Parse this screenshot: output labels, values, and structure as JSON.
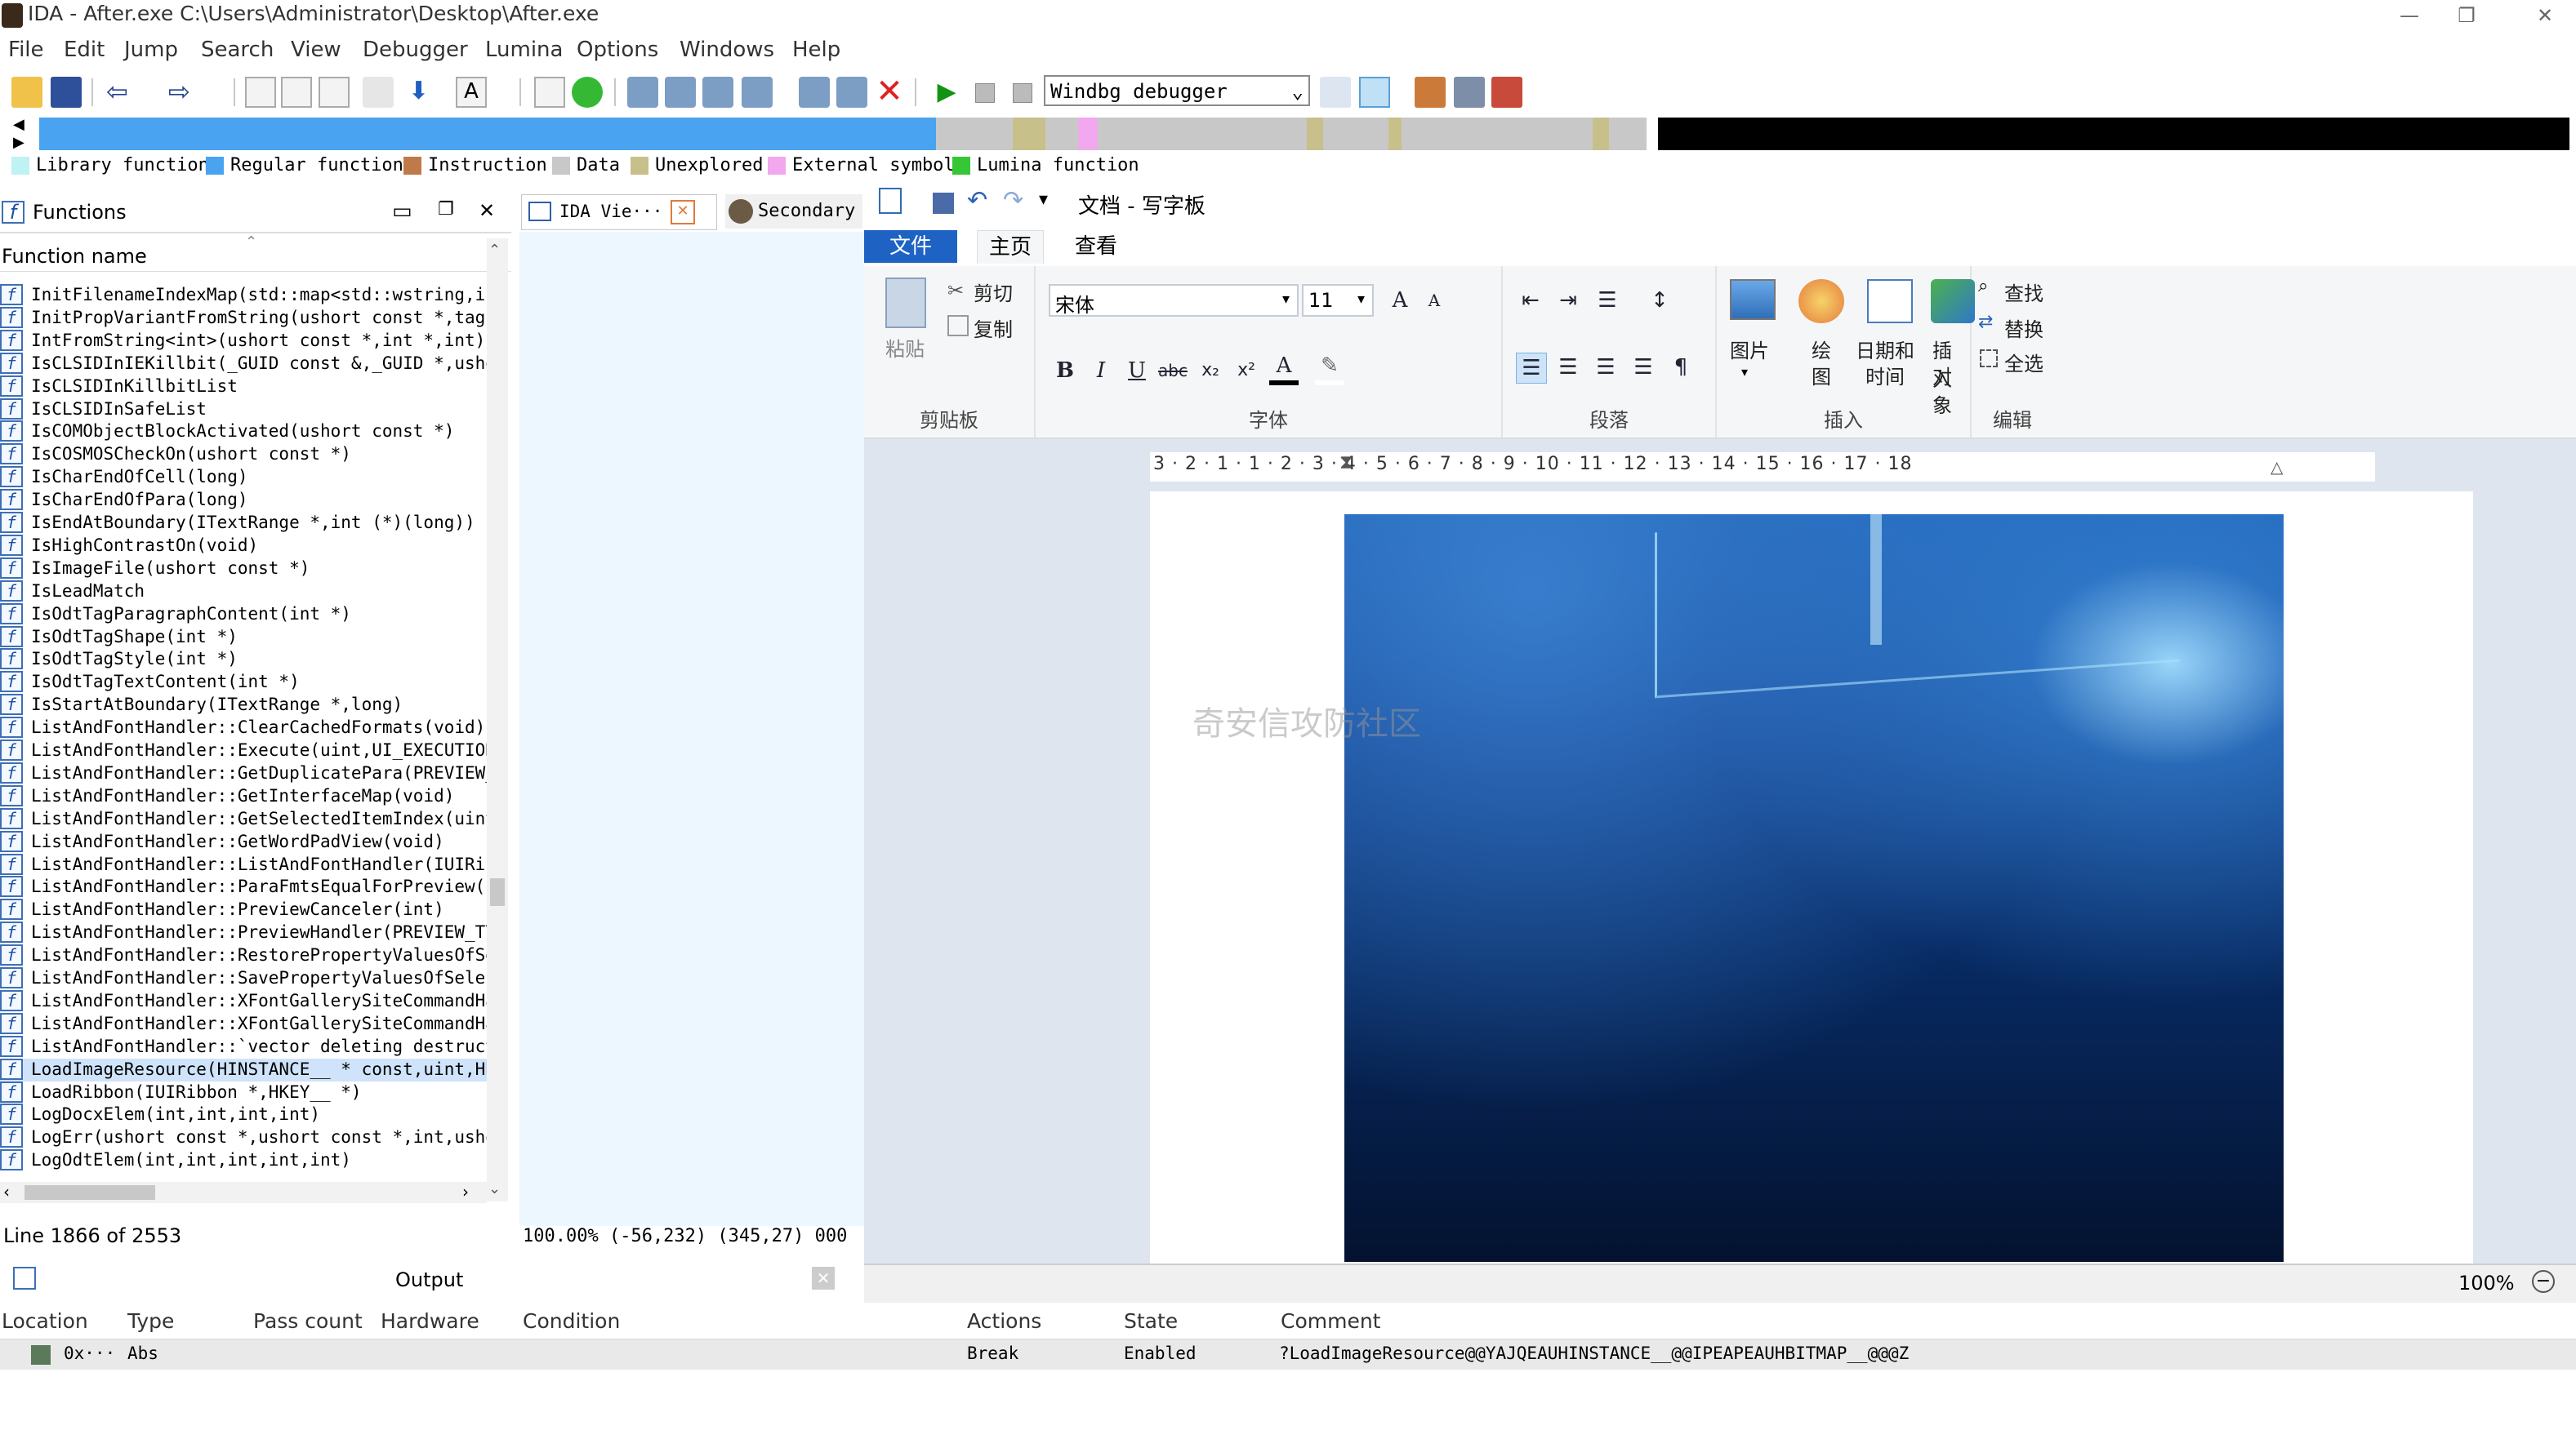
{
  "window": {
    "title": "IDA - After.exe C:\\Users\\Administrator\\Desktop\\After.exe"
  },
  "menu": [
    "File",
    "Edit",
    "Jump",
    "Search",
    "View",
    "Debugger",
    "Lumina",
    "Options",
    "Windows",
    "Help"
  ],
  "toolbar": {
    "debugger_select": "Windbg debugger",
    "icons": [
      "open-icon",
      "save-icon",
      "back-icon",
      "forward-icon",
      "hex-icon",
      "run-icon",
      "pause-icon",
      "stop-icon",
      "close-red-icon"
    ]
  },
  "legend": [
    {
      "label": "Library function",
      "color": "#bff2f2"
    },
    {
      "label": "Regular function",
      "color": "#4aa3f0"
    },
    {
      "label": "Instruction",
      "color": "#c07a4a"
    },
    {
      "label": "Data",
      "color": "#c8c8c8"
    },
    {
      "label": "Unexplored",
      "color": "#c8c08a"
    },
    {
      "label": "External symbol",
      "color": "#f2a8ee"
    },
    {
      "label": "Lumina function",
      "color": "#35c735"
    }
  ],
  "functions_panel": {
    "title": "Functions",
    "column": "Function name",
    "rows": [
      "InitFilenameIndexMap(std::map<std::wstring,int",
      "InitPropVariantFromString(ushort const *,tagPF",
      "IntFromString<int>(ushort const *,int *,int)",
      "IsCLSIDInIEKillbit(_GUID const &,_GUID *,ushor",
      "IsCLSIDInKillbitList",
      "IsCLSIDInSafeList",
      "IsCOMObjectBlockActivated(ushort const *)",
      "IsCOSMOSCheckOn(ushort const *)",
      "IsCharEndOfCell(long)",
      "IsCharEndOfPara(long)",
      "IsEndAtBoundary(ITextRange *,int (*)(long))",
      "IsHighContrastOn(void)",
      "IsImageFile(ushort const *)",
      "IsLeadMatch",
      "IsOdtTagParagraphContent(int *)",
      "IsOdtTagShape(int *)",
      "IsOdtTagStyle(int *)",
      "IsOdtTagTextContent(int *)",
      "IsStartAtBoundary(ITextRange *,long)",
      "ListAndFontHandler::ClearCachedFormats(void)",
      "ListAndFontHandler::Execute(uint,UI_EXECUTIONV",
      "ListAndFontHandler::GetDuplicatePara(PREVIEW_I",
      "ListAndFontHandler::GetInterfaceMap(void)",
      "ListAndFontHandler::GetSelectedItemIndex(uint,",
      "ListAndFontHandler::GetWordPadView(void)",
      "ListAndFontHandler::ListAndFontHandler(IUIRibb",
      "ListAndFontHandler::ParaFmtsEqualForPreview(PF",
      "ListAndFontHandler::PreviewCanceler(int)",
      "ListAndFontHandler::PreviewHandler(PREVIEW_TYF",
      "ListAndFontHandler::RestorePropertyValuesOfSel",
      "ListAndFontHandler::SavePropertyValuesOfSelect",
      "ListAndFontHandler::XFontGallerySiteCommandHar",
      "ListAndFontHandler::XFontGallerySiteCommandHar",
      "ListAndFontHandler::`vector deleting destructo",
      "LoadImageResource(HINSTANCE__ * const,uint,HBI",
      "LoadRibbon(IUIRibbon *,HKEY__ *)",
      "LogDocxElem(int,int,int,int)",
      "LogErr(ushort const *,ushort const *,int,ushor",
      "LogOdtElem(int,int,int,int,int)"
    ],
    "selected_index": 34,
    "status": "Line 1866 of 2553"
  },
  "ida_view": {
    "tab1": "IDA Vie···",
    "tab2": "Secondary",
    "status": "100.00% (-56,232) (345,27) 000"
  },
  "wordpad": {
    "title": "文档 - 写字板",
    "tabs": [
      "文件",
      "主页",
      "查看"
    ],
    "clipboard": {
      "paste": "粘贴",
      "cut": "剪切",
      "copy": "复制",
      "label": "剪贴板"
    },
    "font": {
      "name": "宋体",
      "size": "11",
      "label": "字体"
    },
    "paragraph_label": "段落",
    "insert": {
      "picture": "图片",
      "draw_top": "绘",
      "draw_bottom": "图",
      "datetime_top": "日期和",
      "datetime_bottom": "时间",
      "object_top": "插入",
      "object_bottom": "对象",
      "label": "插入"
    },
    "edit": {
      "find": "查找",
      "replace": "替换",
      "select_all": "全选",
      "label": "编辑"
    },
    "ruler": "3 · 2 · 1 · 1 · 2 · 3 · 4 · 5 · 6 · 7 · 8 · 9 · 10 · 11 · 12 · 13 · 14 · 15 · 16 · 17 · 18",
    "zoom": "100%",
    "watermark": "奇安信攻防社区"
  },
  "output": {
    "title": "Output"
  },
  "breakpoints": {
    "headers": [
      "Location",
      "Type",
      "Pass count",
      "Hardware",
      "Condition",
      "Actions",
      "State",
      "Comment"
    ],
    "row": {
      "location": "0x···",
      "type": "Abs",
      "actions": "Break",
      "state": "Enabled",
      "comment": "?LoadImageResource@@YAJQEAUHINSTANCE__@@IPEAPEAUHBITMAP__@@@Z"
    }
  }
}
